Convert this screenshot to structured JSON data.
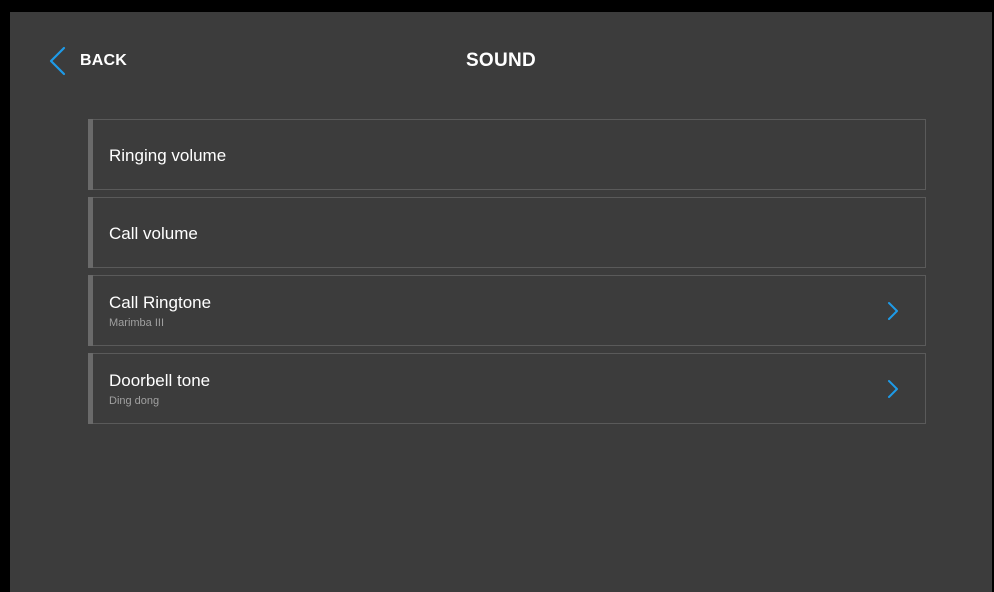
{
  "header": {
    "back_label": "BACK",
    "title": "SOUND"
  },
  "sound_settings": {
    "items": [
      {
        "label": "Ringing volume",
        "value": "",
        "has_chevron": false
      },
      {
        "label": "Call volume",
        "value": "",
        "has_chevron": false
      },
      {
        "label": "Call Ringtone",
        "value": "Marimba III",
        "has_chevron": true
      },
      {
        "label": "Doorbell tone",
        "value": "Ding dong",
        "has_chevron": true
      }
    ]
  },
  "colors": {
    "background": "#3c3c3c",
    "accent": "#1e9be8",
    "text": "#ffffff",
    "subtext": "#a0a0a0",
    "border": "#5a5a5a"
  },
  "icons": {
    "back": "chevron-left-icon",
    "item_arrow": "chevron-right-icon"
  }
}
